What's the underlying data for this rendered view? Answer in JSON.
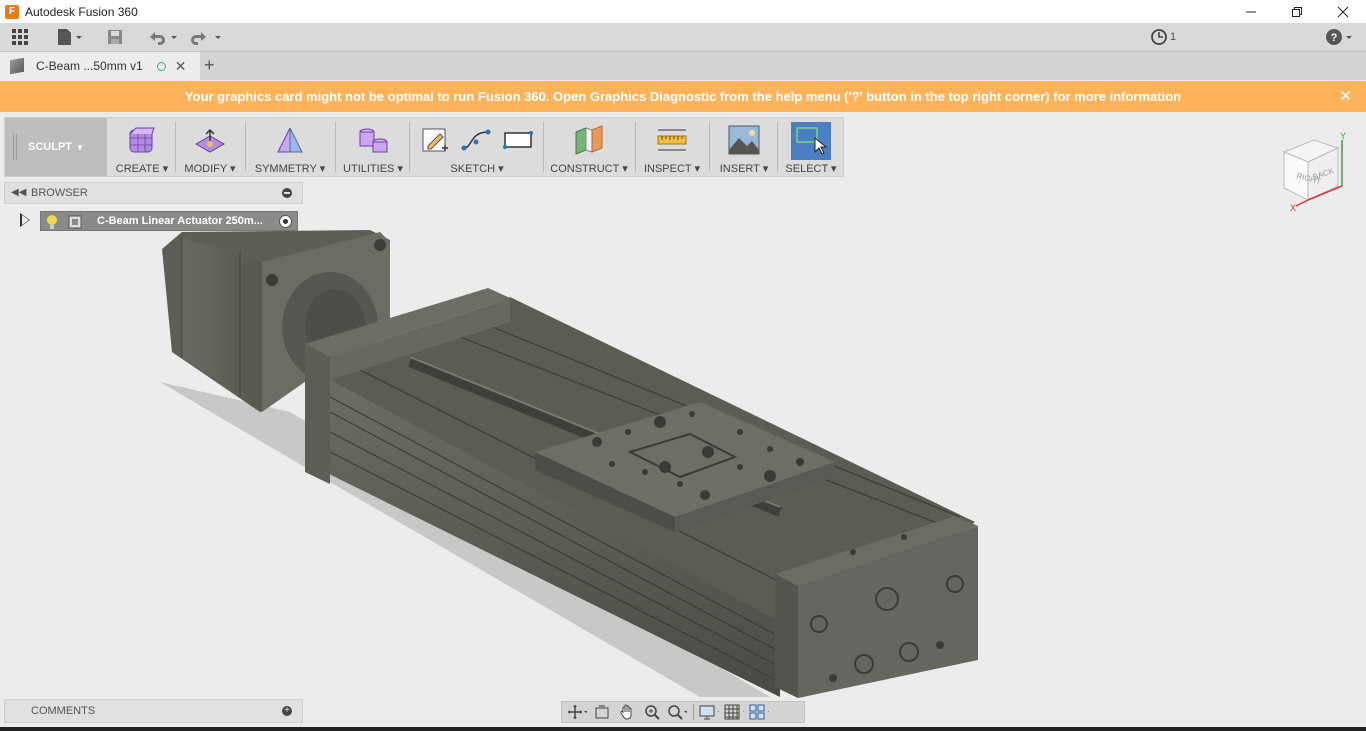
{
  "window": {
    "title": "Autodesk Fusion 360",
    "logo_letter": "F"
  },
  "qat": {
    "job_count": "1"
  },
  "doc_tab": {
    "name": "C-Beam ...50mm v1"
  },
  "banner": {
    "message": "Your graphics card might not be optimal to run Fusion 360. Open Graphics Diagnostic from the help menu ('?' button in the top right corner) for more information"
  },
  "toolbar": {
    "workspace": "SCULPT",
    "groups": {
      "create": "CREATE",
      "modify": "MODIFY",
      "symmetry": "SYMMETRY",
      "utilities": "UTILITIES",
      "sketch": "SKETCH",
      "construct": "CONSTRUCT",
      "inspect": "INSPECT",
      "insert": "INSERT",
      "select": "SELECT"
    }
  },
  "browser": {
    "title": "BROWSER",
    "root_node": "C-Beam Linear Actuator 250m..."
  },
  "comments": {
    "title": "COMMENTS"
  },
  "viewcube": {
    "face_right": "RIGHT",
    "face_back": "BACK",
    "axis_x": "X",
    "axis_y": "Y"
  },
  "colors": {
    "banner": "#fdb35b",
    "accent": "#3aa98a",
    "select_blue": "#4a7fc1"
  }
}
